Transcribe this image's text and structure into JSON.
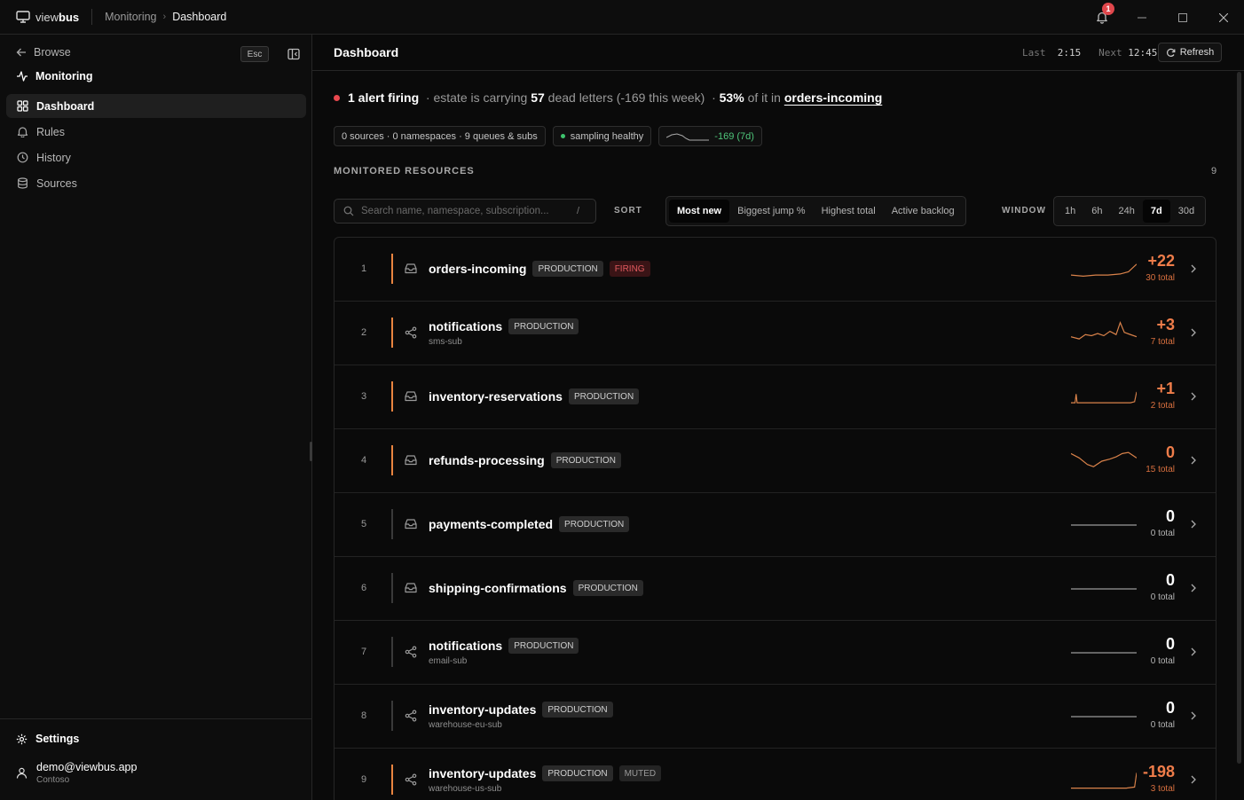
{
  "app": {
    "brand_light": "view",
    "brand_bold": "bus"
  },
  "breadcrumb": [
    "Monitoring",
    "Dashboard"
  ],
  "notifications": {
    "count": "1"
  },
  "sidebar": {
    "back_label": "Browse",
    "esc_label": "Esc",
    "section_label": "Monitoring",
    "items": [
      {
        "label": "Dashboard",
        "icon": "grid-icon",
        "active": true
      },
      {
        "label": "Rules",
        "icon": "bell-icon"
      },
      {
        "label": "History",
        "icon": "clock-icon"
      },
      {
        "label": "Sources",
        "icon": "database-icon"
      }
    ],
    "settings_label": "Settings",
    "user": {
      "email": "demo@viewbus.app",
      "org": "Contoso"
    }
  },
  "header": {
    "title": "Dashboard",
    "last_label": "Last",
    "last_value": "2:15",
    "next_label": "Next",
    "next_value": "12:45",
    "refresh_label": "Refresh"
  },
  "summary": {
    "alert_text": "1 alert firing",
    "sep1": "· estate is carrying",
    "dead_count": "57",
    "dead_suffix": "dead letters (-169 this week)",
    "sep2": "·",
    "pct": "53%",
    "pct_suffix": "of it in",
    "top_resource": "orders-incoming"
  },
  "chips": {
    "counts": "0 sources · 0 namespaces · 9 queues & subs",
    "sampling": "sampling healthy",
    "trend": "-169 (7d)"
  },
  "resources": {
    "title": "MONITORED RESOURCES",
    "count": "9",
    "search_placeholder": "Search name, namespace, subscription...",
    "search_shortcut": "/",
    "sort_label": "SORT",
    "sort_options": [
      "Most new",
      "Biggest jump %",
      "Highest total",
      "Active backlog"
    ],
    "window_label": "WINDOW",
    "window_options": [
      "1h",
      "6h",
      "24h",
      "7d",
      "30d"
    ]
  },
  "rows": [
    {
      "idx": "1",
      "name": "orders-incoming",
      "sub": "",
      "kind": "queue",
      "tags": [
        "PRODUCTION",
        "FIRING"
      ],
      "delta": "+22",
      "total": "30 total",
      "hot": true
    },
    {
      "idx": "2",
      "name": "notifications",
      "sub": "sms-sub",
      "kind": "subscription",
      "tags": [
        "PRODUCTION"
      ],
      "delta": "+3",
      "total": "7 total",
      "hot": true
    },
    {
      "idx": "3",
      "name": "inventory-reservations",
      "sub": "",
      "kind": "queue",
      "tags": [
        "PRODUCTION"
      ],
      "delta": "+1",
      "total": "2 total",
      "hot": true
    },
    {
      "idx": "4",
      "name": "refunds-processing",
      "sub": "",
      "kind": "queue",
      "tags": [
        "PRODUCTION"
      ],
      "delta": "0",
      "total": "15 total",
      "hot": true
    },
    {
      "idx": "5",
      "name": "payments-completed",
      "sub": "",
      "kind": "queue",
      "tags": [
        "PRODUCTION"
      ],
      "delta": "0",
      "total": "0 total",
      "hot": false
    },
    {
      "idx": "6",
      "name": "shipping-confirmations",
      "sub": "",
      "kind": "queue",
      "tags": [
        "PRODUCTION"
      ],
      "delta": "0",
      "total": "0 total",
      "hot": false
    },
    {
      "idx": "7",
      "name": "notifications",
      "sub": "email-sub",
      "kind": "subscription",
      "tags": [
        "PRODUCTION"
      ],
      "delta": "0",
      "total": "0 total",
      "hot": false
    },
    {
      "idx": "8",
      "name": "inventory-updates",
      "sub": "warehouse-eu-sub",
      "kind": "subscription",
      "tags": [
        "PRODUCTION"
      ],
      "delta": "0",
      "total": "0 total",
      "hot": false
    },
    {
      "idx": "9",
      "name": "inventory-updates",
      "sub": "warehouse-us-sub",
      "kind": "subscription",
      "tags": [
        "PRODUCTION",
        "MUTED"
      ],
      "delta": "-198",
      "total": "3 total",
      "hot": true
    }
  ],
  "colors": {
    "accent": "#ef7d4a",
    "alert": "#e9484e",
    "healthy": "#3ec46d"
  }
}
